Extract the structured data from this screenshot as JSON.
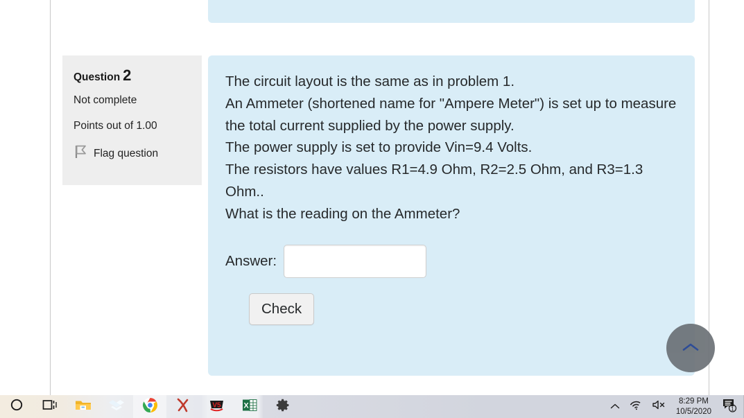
{
  "question_info": {
    "question_label": "Question",
    "question_number": "2",
    "status": "Not complete",
    "points": "Points out of 1.00",
    "flag_label": "Flag question",
    "flag_icon": "flag-icon"
  },
  "question": {
    "text": "The circuit layout is the same as in problem 1.\nAn Ammeter (shortened name for \"Ampere Meter\") is set up to measure the total current supplied by the power supply.\nThe power supply is set to provide Vin=9.4 Volts.\nThe resistors have values R1=4.9 Ohm,  R2=2.5 Ohm, and R3=1.3 Ohm..\nWhat is the reading on the Ammeter?",
    "answer_label": "Answer:",
    "answer_value": "",
    "answer_placeholder": "",
    "check_label": "Check"
  },
  "floating": {
    "scroll_top_icon": "chevron-up-icon"
  },
  "taskbar": {
    "apps": [
      {
        "name": "cortana-icon",
        "label": "Cortana",
        "active": false
      },
      {
        "name": "task-view-icon",
        "label": "Task View",
        "active": false
      },
      {
        "name": "file-explorer-icon",
        "label": "File Explorer",
        "active": false
      },
      {
        "name": "dropbox-icon",
        "label": "Dropbox",
        "active": false
      },
      {
        "name": "chrome-icon",
        "label": "Google Chrome",
        "active": true
      },
      {
        "name": "xournal-icon",
        "label": "Xournal",
        "active": false
      },
      {
        "name": "v5-icon",
        "label": "V5",
        "active": false
      },
      {
        "name": "excel-icon",
        "label": "Excel",
        "active": false
      },
      {
        "name": "settings-gear-icon",
        "label": "Settings",
        "active": false
      }
    ],
    "tray": {
      "show_hidden_icon": "chevron-up-icon",
      "network_icon": "wifi-icon",
      "volume_icon": "speaker-muted-icon",
      "time": "8:29 PM",
      "date": "10/5/2020",
      "notification_icon": "notification-icon",
      "notification_count": "1"
    }
  },
  "colors": {
    "panel_bg": "#d9edf7",
    "info_bg": "#eeeeee",
    "text": "#26292b",
    "scroll_button_bg": "#6b7176",
    "chevron": "#1f3f8f"
  }
}
